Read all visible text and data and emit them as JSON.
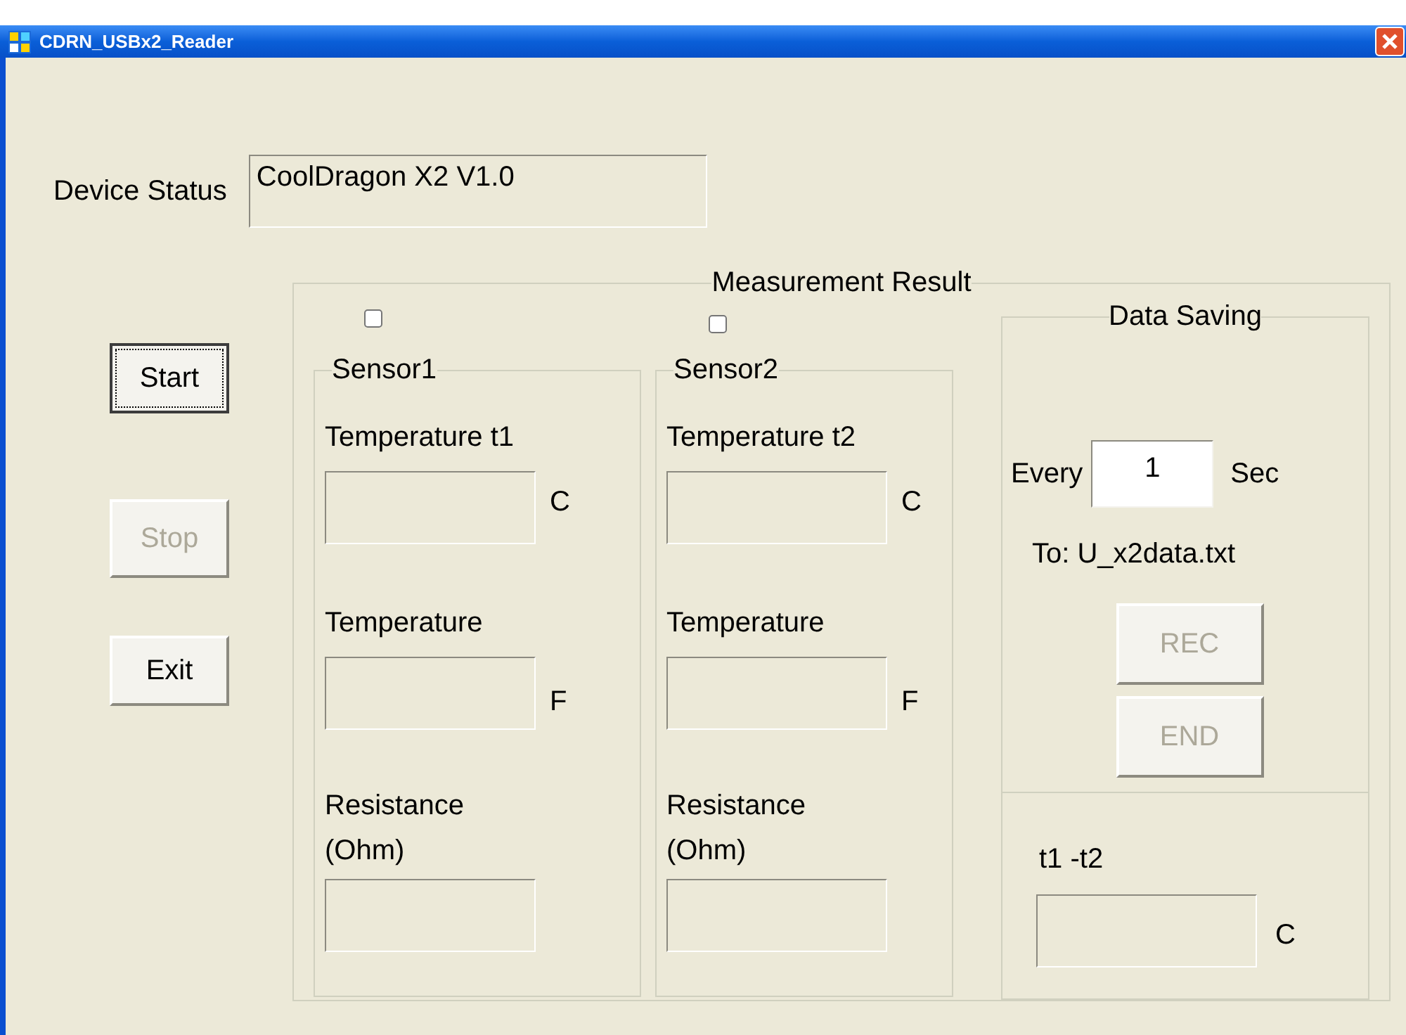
{
  "window": {
    "title": "CDRN_USBx2_Reader"
  },
  "device_status": {
    "label": "Device Status",
    "value": "CoolDragon X2 V1.0"
  },
  "buttons": [
    {
      "label": "Start",
      "disabled": false,
      "focused": true
    },
    {
      "label": "Stop",
      "disabled": true,
      "focused": false
    },
    {
      "label": "Exit",
      "disabled": false,
      "focused": false
    }
  ],
  "measurement": {
    "title": "Measurement Result",
    "sensors": [
      {
        "checked": false,
        "title": "Sensor1",
        "fields": [
          {
            "label": "Temperature t1",
            "unit": "C"
          },
          {
            "label": "Temperature",
            "unit": "F"
          },
          {
            "label": "Resistance\n(Ohm)"
          }
        ]
      },
      {
        "checked": false,
        "title": "Sensor2",
        "fields": [
          {
            "label": "Temperature t2",
            "unit": "C"
          },
          {
            "label": "Temperature",
            "unit": "F"
          },
          {
            "label": "Resistance\n(Ohm)"
          }
        ]
      }
    ],
    "data_saving": {
      "title": "Data Saving",
      "interval_label": "Every",
      "interval": "1",
      "interval_unit": "Sec",
      "target": "To: U_x2data.txt",
      "buttons": [
        {
          "label": "REC",
          "disabled": true
        },
        {
          "label": "END",
          "disabled": true
        }
      ]
    },
    "difference": {
      "label": "t1 -t2",
      "unit": "C"
    }
  }
}
